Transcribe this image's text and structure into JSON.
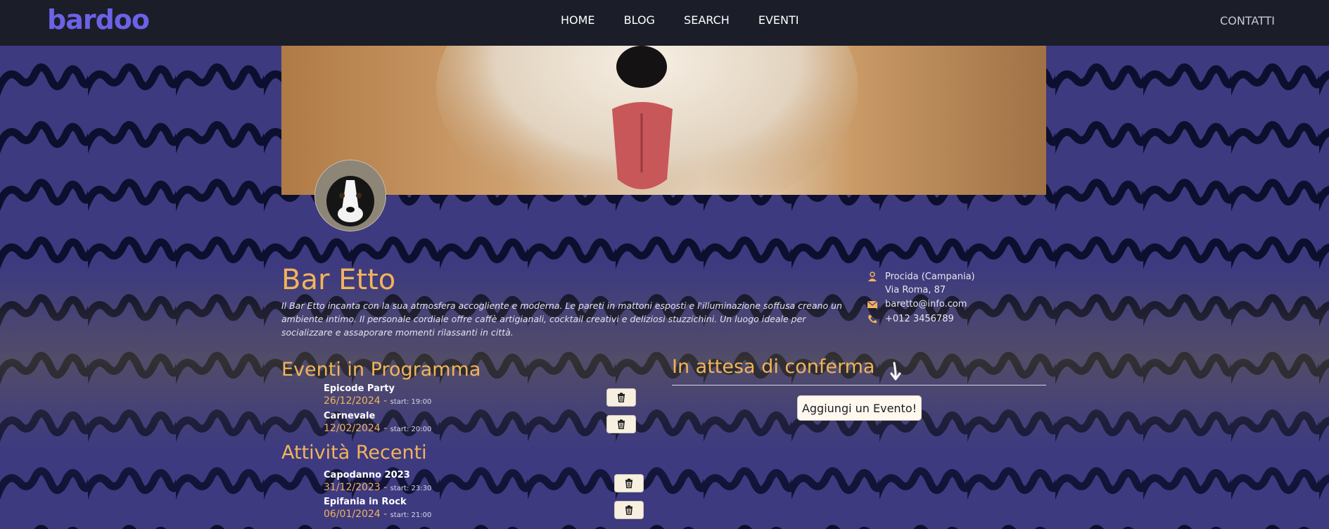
{
  "navbar": {
    "logo": "bardoo",
    "links": [
      "HOME",
      "BLOG",
      "SEARCH",
      "EVENTI"
    ],
    "contact": "CONTATTI"
  },
  "venue": {
    "name": "Bar Etto",
    "description": "Il Bar Etto incanta con la sua atmosfera accogliente e moderna. Le pareti in mattoni esposti e l'illuminazione soffusa creano un ambiente intimo. Il personale cordiale offre caffè artigianali, cocktail creativi e deliziosi stuzzichini. Un luogo ideale per socializzare e assaporare momenti rilassanti in città.",
    "location": "Procida (Campania)",
    "address": "Via Roma, 87",
    "email": "baretto@info.com",
    "phone": "+012 3456789"
  },
  "upcoming": {
    "title": "Eventi in Programma",
    "events": [
      {
        "name": "Epicode Party",
        "date": "26/12/2024 - ",
        "start": "start: 19:00"
      },
      {
        "name": "Carnevale",
        "date": "12/02/2024 - ",
        "start": "start: 20:00"
      }
    ]
  },
  "recent": {
    "title": "Attività Recenti",
    "events": [
      {
        "name": "Capodanno 2023",
        "date": "31/12/2023 - ",
        "start": "start: 23:30"
      },
      {
        "name": "Epifania in Rock",
        "date": "06/01/2024 - ",
        "start": "start: 21:00"
      }
    ]
  },
  "pending": {
    "title": "In attesa di conferma",
    "add_button": "Aggiungi un Evento!"
  },
  "icons": {
    "trash": "trash-icon",
    "location": "person-pin-icon",
    "email": "envelope-icon",
    "phone": "phone-icon",
    "arrow": "arrow-down-icon"
  },
  "colors": {
    "accent": "#f2b35a",
    "navbar": "#1b1d29",
    "logo": "#6b62e6",
    "background": "#3d3a80"
  }
}
